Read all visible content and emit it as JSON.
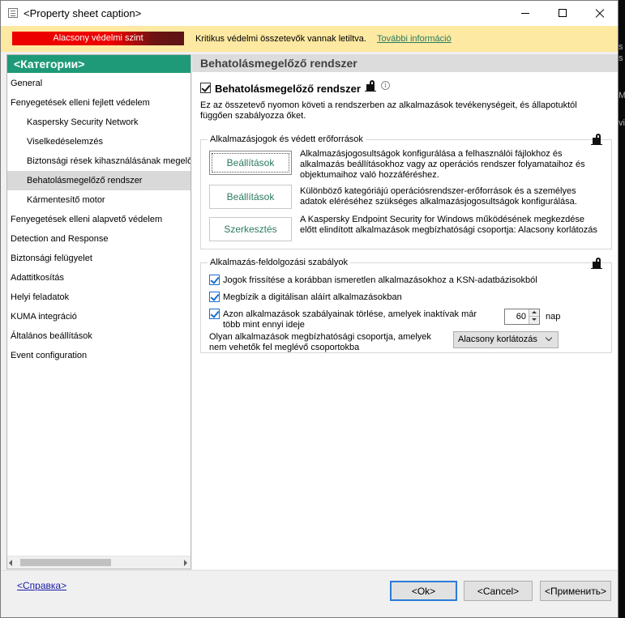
{
  "window": {
    "title": "<Property sheet caption>"
  },
  "warning_bar": {
    "protection_level": "Alacsony védelmi szint",
    "message": "Kritikus védelmi összetevők vannak letiltva.",
    "link": "További információ",
    "colors": {
      "background": "#fde9a2",
      "badge": "#ec0000",
      "link": "#2a7a5e"
    }
  },
  "sidebar": {
    "header": "<Категории>",
    "header_color": "#1e9a78",
    "items": [
      {
        "label": "General"
      },
      {
        "label": "Fenyegetések elleni fejlett védelem"
      },
      {
        "label": "Kaspersky Security Network"
      },
      {
        "label": "Viselkedéselemzés"
      },
      {
        "label": "Biztonsági rések kihasználásának megelőzése"
      },
      {
        "label": "Behatolásmegelőző rendszer"
      },
      {
        "label": "Kármentesítő motor"
      },
      {
        "label": "Fenyegetések elleni alapvető védelem"
      },
      {
        "label": "Detection and Response"
      },
      {
        "label": "Biztonsági felügyelet"
      },
      {
        "label": "Adattitkosítás"
      },
      {
        "label": "Helyi feladatok"
      },
      {
        "label": "KUMA integráció"
      },
      {
        "label": "Általános beállítások"
      },
      {
        "label": "Event configuration"
      }
    ]
  },
  "main": {
    "header": "Behatolásmegelőző rendszer",
    "enable_label": "Behatolásmegelőző rendszer",
    "enable_checked": true,
    "description": "Ez az összetevő nyomon követi a rendszerben az alkalmazások tevékenységeit, és állapotuktól függően szabályozza őket.",
    "rights_group": {
      "title": "Alkalmazásjogok és védett erőforrások",
      "rows": [
        {
          "button": "Beállítások",
          "text": "Alkalmazásjogosultságok konfigurálása a felhasználói fájlokhoz és alkalmazás beállításokhoz vagy az operációs rendszer folyamataihoz és objektumaihoz való hozzáféréshez."
        },
        {
          "button": "Beállítások",
          "text": "Különböző kategóriájú operációsrendszer-erőforrások és a személyes adatok eléréséhez szükséges alkalmazásjogosultságok konfigurálása."
        },
        {
          "button": "Szerkesztés",
          "text": "A Kaspersky Endpoint Security for Windows működésének megkezdése előtt elindított alkalmazások megbízhatósági csoportja: Alacsony korlátozás"
        }
      ]
    },
    "processing_group": {
      "title": "Alkalmazás-feldolgozási szabályok",
      "rules": [
        {
          "label": "Jogok frissítése a korábban ismeretlen alkalmazásokhoz a KSN-adatbázisokból",
          "checked": true
        },
        {
          "label": "Megbízik a digitálisan aláírt alkalmazásokban",
          "checked": true
        },
        {
          "label": "Azon alkalmazások szabályainak törlése, amelyek inaktívak már több mint ennyi ideje",
          "checked": true
        }
      ],
      "inactive_days": "60",
      "days_unit": "nap",
      "trust_group_label": "Olyan alkalmazások megbízhatósági csoportja, amelyek nem vehetők fel meglévő csoportokba",
      "trust_group_value": "Alacsony korlátozás"
    }
  },
  "footer": {
    "help_link": "<Справка>",
    "ok": "<Ok>",
    "cancel": "<Cancel>",
    "apply": "<Применить>"
  },
  "background_fragments": [
    "s",
    "s",
    "Ma",
    "vi"
  ]
}
